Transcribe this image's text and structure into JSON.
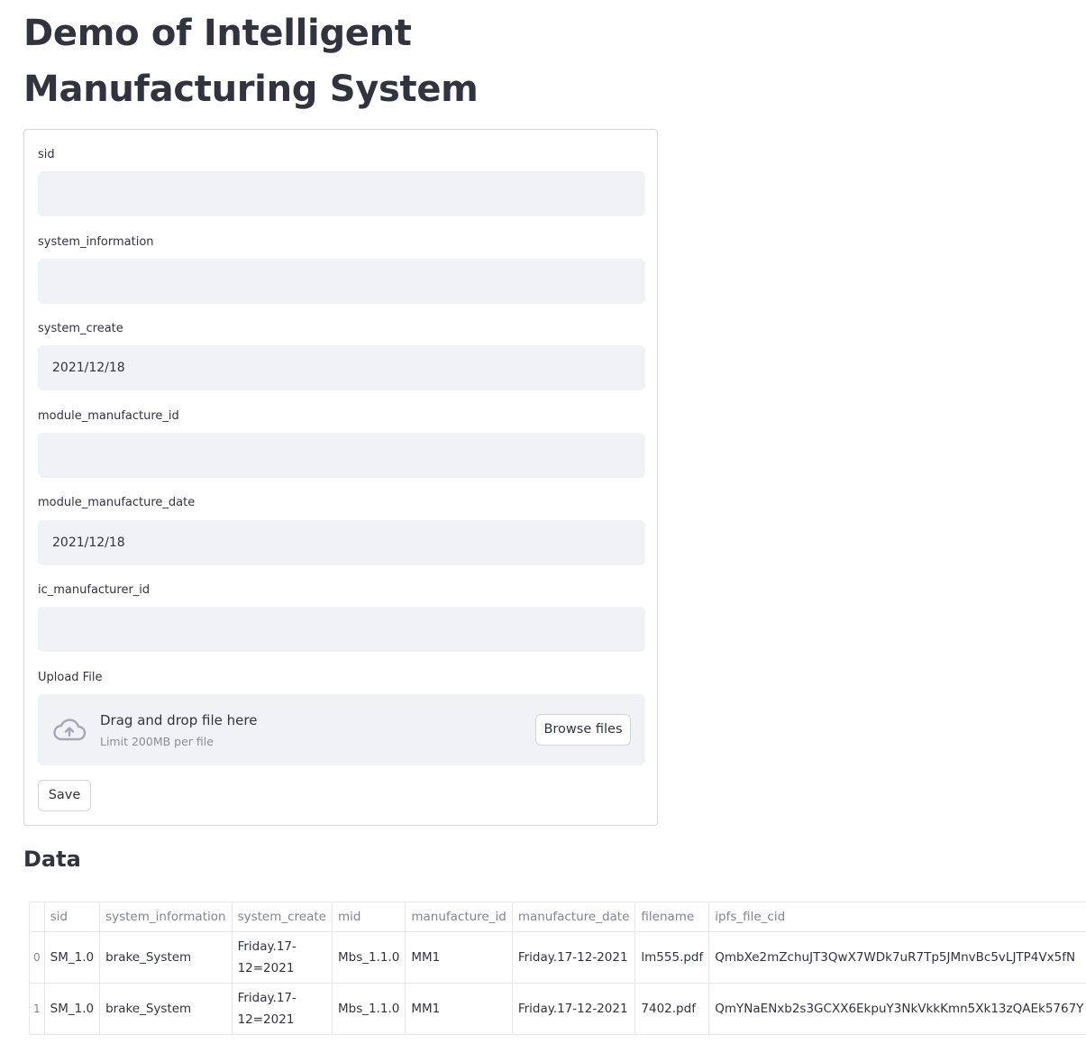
{
  "page": {
    "title": "Demo of Intelligent Manufacturing System"
  },
  "form": {
    "fields": [
      {
        "label": "sid",
        "value": ""
      },
      {
        "label": "system_information",
        "value": ""
      },
      {
        "label": "system_create",
        "value": "2021/12/18"
      },
      {
        "label": "module_manufacture_id",
        "value": ""
      },
      {
        "label": "module_manufacture_date",
        "value": "2021/12/18"
      },
      {
        "label": "ic_manufacturer_id",
        "value": ""
      }
    ],
    "upload": {
      "label": "Upload File",
      "dropzone_title": "Drag and drop file here",
      "dropzone_limit": "Limit 200MB per file",
      "browse_label": "Browse files",
      "icon": "cloud-upload-icon"
    },
    "save_label": "Save"
  },
  "data_section": {
    "title": "Data",
    "columns": [
      "",
      "sid",
      "system_information",
      "system_create",
      "mid",
      "manufacture_id",
      "manufacture_date",
      "filename",
      "ipfs_file_cid"
    ],
    "rows": [
      {
        "index": "0",
        "sid": "SM_1.0",
        "system_information": "brake_System",
        "system_create": "Friday.17-12=2021",
        "mid": "Mbs_1.1.0",
        "manufacture_id": "MM1",
        "manufacture_date": "Friday.17-12-2021",
        "filename": "lm555.pdf",
        "ipfs_file_cid": "QmbXe2mZchuJT3QwX7WDk7uR7Tp5JMnvBc5vLJTP4Vx5fN"
      },
      {
        "index": "1",
        "sid": "SM_1.0",
        "system_information": "brake_System",
        "system_create": "Friday.17-12=2021",
        "mid": "Mbs_1.1.0",
        "manufacture_id": "MM1",
        "manufacture_date": "Friday.17-12-2021",
        "filename": "7402.pdf",
        "ipfs_file_cid": "QmYNaENxb2s3GCXX6EkpuY3NkVkkKmn5Xk13zQAEk5767Y"
      }
    ]
  },
  "colors": {
    "text": "#31333f",
    "input_bg": "#f0f2f6",
    "border": "#d6d6d9",
    "muted": "#808495"
  }
}
